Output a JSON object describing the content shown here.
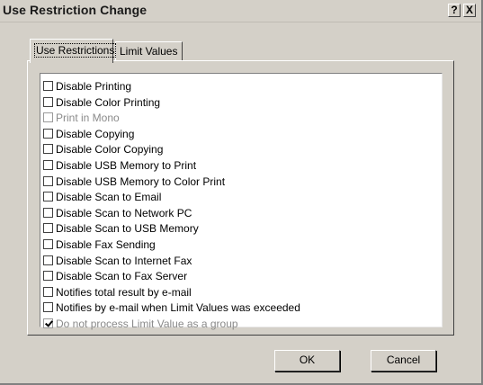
{
  "window": {
    "title": "Use Restriction Change",
    "help_label": "?",
    "close_label": "X"
  },
  "tabs": [
    {
      "label": "Use Restrictions",
      "selected": true
    },
    {
      "label": "Limit Values",
      "selected": false
    }
  ],
  "restrictions": [
    {
      "label": "Disable Printing",
      "checked": false,
      "enabled": true
    },
    {
      "label": "Disable Color Printing",
      "checked": false,
      "enabled": true
    },
    {
      "label": "Print in Mono",
      "checked": false,
      "enabled": false
    },
    {
      "label": "Disable Copying",
      "checked": false,
      "enabled": true
    },
    {
      "label": "Disable Color Copying",
      "checked": false,
      "enabled": true
    },
    {
      "label": "Disable USB Memory to Print",
      "checked": false,
      "enabled": true
    },
    {
      "label": "Disable USB Memory to Color Print",
      "checked": false,
      "enabled": true
    },
    {
      "label": "Disable Scan to Email",
      "checked": false,
      "enabled": true
    },
    {
      "label": "Disable Scan to Network PC",
      "checked": false,
      "enabled": true
    },
    {
      "label": "Disable Scan to USB Memory",
      "checked": false,
      "enabled": true
    },
    {
      "label": "Disable Fax Sending",
      "checked": false,
      "enabled": true
    },
    {
      "label": "Disable Scan to Internet Fax",
      "checked": false,
      "enabled": true
    },
    {
      "label": "Disable Scan to Fax Server",
      "checked": false,
      "enabled": true
    },
    {
      "label": "Notifies total result by e-mail",
      "checked": false,
      "enabled": true
    },
    {
      "label": "Notifies by e-mail when Limit Values was exceeded",
      "checked": false,
      "enabled": true
    },
    {
      "label": "Do not process Limit Value as a group",
      "checked": true,
      "enabled": false
    }
  ],
  "buttons": {
    "ok": "OK",
    "cancel": "Cancel"
  }
}
